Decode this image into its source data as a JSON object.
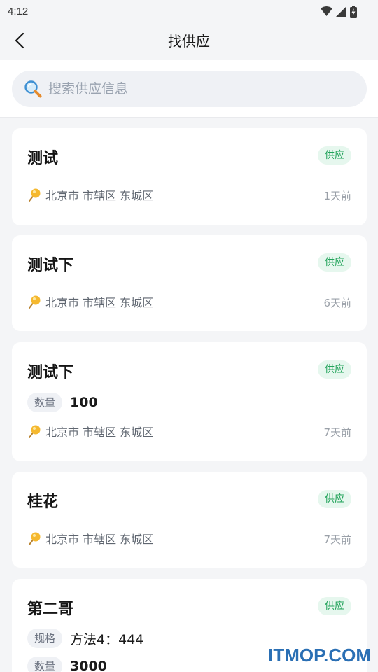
{
  "status_bar": {
    "time": "4:12"
  },
  "header": {
    "title": "找供应"
  },
  "search": {
    "placeholder": "搜索供应信息"
  },
  "items": [
    {
      "title": "测试",
      "badge": "供应",
      "location": "北京市 市辖区 东城区",
      "time": "1天前"
    },
    {
      "title": "测试下",
      "badge": "供应",
      "location": "北京市 市辖区 东城区",
      "time": "6天前"
    },
    {
      "title": "测试下",
      "badge": "供应",
      "attrs": [
        {
          "key": "数量",
          "value": "100"
        }
      ],
      "location": "北京市 市辖区 东城区",
      "time": "7天前"
    },
    {
      "title": "桂花",
      "badge": "供应",
      "location": "北京市 市辖区 东城区",
      "time": "7天前"
    },
    {
      "title": "第二哥",
      "badge": "供应",
      "attrs": [
        {
          "key": "规格",
          "value": "方法4：444"
        },
        {
          "key": "数量",
          "value": "3000"
        }
      ]
    }
  ],
  "watermark": "ITMOP.COM",
  "colors": {
    "badge_bg": "#e6f7ee",
    "badge_text": "#21a35a",
    "page_bg": "#f4f5f7"
  }
}
